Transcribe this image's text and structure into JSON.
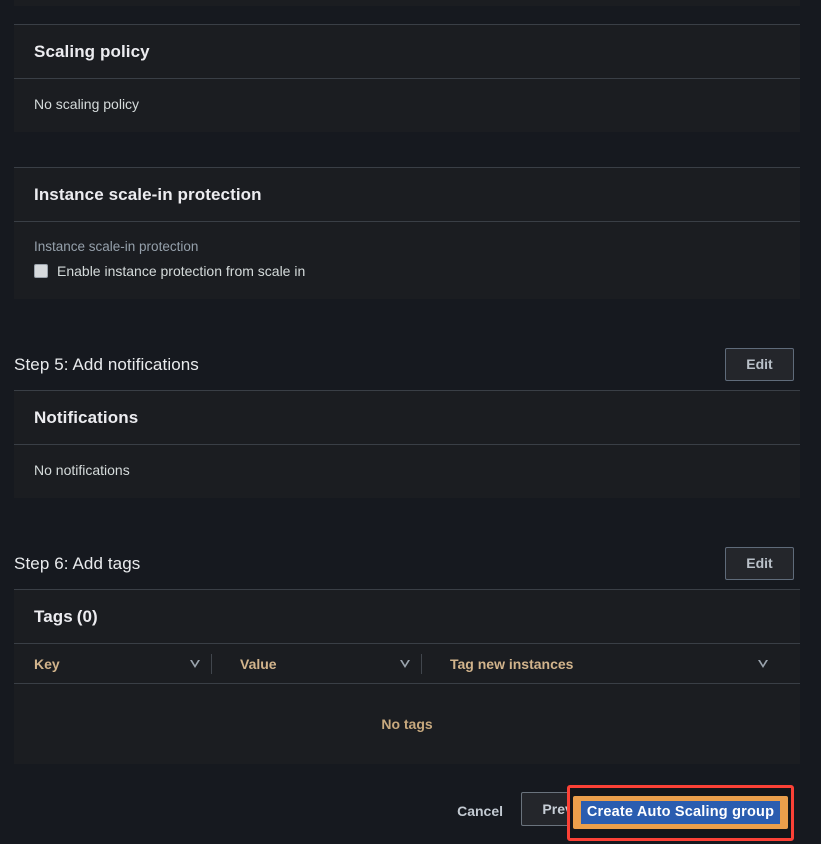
{
  "theme": {
    "page_bg": "#16191f",
    "card_bg": "#1b1d21",
    "border": "#3a3f46",
    "accent_orange": "#eb9f4b",
    "highlight_red": "#fc4136",
    "selection_blue": "#2a5db0",
    "table_header_text": "#d2b48c"
  },
  "scaling_policy": {
    "title": "Scaling policy",
    "empty_text": "No scaling policy"
  },
  "scale_in_protection": {
    "title": "Instance scale-in protection",
    "field_label": "Instance scale-in protection",
    "checkbox_label": "Enable instance protection from scale in",
    "checked": false
  },
  "step5": {
    "title": "Step 5: Add notifications",
    "edit_label": "Edit",
    "card_title": "Notifications",
    "empty_text": "No notifications"
  },
  "step6": {
    "title": "Step 6: Add tags",
    "edit_label": "Edit",
    "card_title": "Tags",
    "count": "(0)",
    "columns": [
      {
        "label": "Key",
        "sort_icon": "sort-caret-icon"
      },
      {
        "label": "Value",
        "sort_icon": "sort-caret-icon"
      },
      {
        "label": "Tag new instances",
        "sort_icon": "sort-caret-icon"
      }
    ],
    "empty_text": "No tags"
  },
  "footer": {
    "cancel_label": "Cancel",
    "previous_label": "Previous",
    "create_label": "Create Auto Scaling group"
  }
}
